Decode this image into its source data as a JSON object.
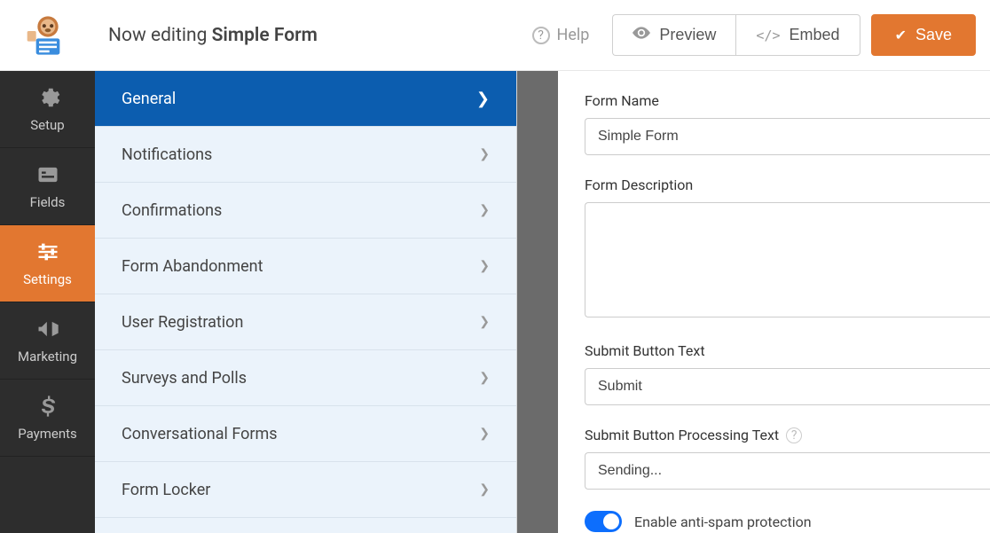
{
  "topbar": {
    "title_prefix": "Now editing ",
    "title_name": "Simple Form",
    "help_label": "Help",
    "preview_label": "Preview",
    "embed_label": "Embed",
    "save_label": "Save"
  },
  "sidebar": {
    "items": [
      {
        "label": "Setup"
      },
      {
        "label": "Fields"
      },
      {
        "label": "Settings"
      },
      {
        "label": "Marketing"
      },
      {
        "label": "Payments"
      }
    ]
  },
  "settings_panel": {
    "items": [
      {
        "label": "General",
        "active": true
      },
      {
        "label": "Notifications"
      },
      {
        "label": "Confirmations"
      },
      {
        "label": "Form Abandonment"
      },
      {
        "label": "User Registration"
      },
      {
        "label": "Surveys and Polls"
      },
      {
        "label": "Conversational Forms"
      },
      {
        "label": "Form Locker"
      }
    ]
  },
  "form": {
    "form_name_label": "Form Name",
    "form_name_value": "Simple Form",
    "form_desc_label": "Form Description",
    "submit_text_label": "Submit Button Text",
    "submit_text_value": "Submit",
    "submit_processing_label": "Submit Button Processing Text",
    "submit_processing_value": "Sending...",
    "antispam_label": "Enable anti-spam protection"
  }
}
